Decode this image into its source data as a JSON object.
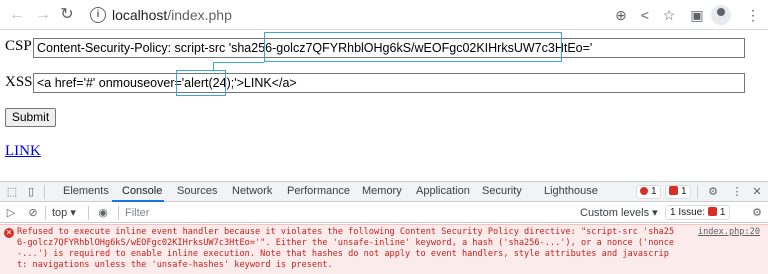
{
  "browser": {
    "url_host": "localhost",
    "url_path": "/index.php",
    "icons": [
      "back-icon",
      "forward-icon",
      "reload-icon",
      "info-icon",
      "zoom-icon",
      "share-icon",
      "bookmark-star-icon",
      "side-panel-icon",
      "profile-avatar",
      "menu-icon"
    ]
  },
  "page": {
    "csp_label": "CSP",
    "csp_value": "Content-Security-Policy: script-src 'sha256-golcz7QFYRhblOHg6kS/wEOFgc02KIHrksUW7c3HtEo='",
    "xss_label": "XSS",
    "xss_value": "<a href='#' onmouseover='alert(24);'>LINK</a>",
    "submit_label": "Submit",
    "link_text": "LINK",
    "highlight_color": "#3aa7d6"
  },
  "devtools": {
    "tabs": [
      "Elements",
      "Console",
      "Sources",
      "Network",
      "Performance",
      "Memory",
      "Application",
      "Security",
      "Lighthouse"
    ],
    "active_tab": "Console",
    "error_count": "1",
    "issue_count": "1",
    "context": "top",
    "filter_placeholder": "Filter",
    "levels_label": "Custom levels ▾",
    "issues_label": "1 Issue:",
    "issues_badge": "1",
    "message": "Refused to execute inline event handler because it violates the following Content Security Policy directive: \"script-src 'sha256-golcz7QFYRhblOHg6kS/wEOFgc02KIHrksUW7c3HtEo='\". Either the 'unsafe-inline' keyword, a hash ('sha256-...'), or a nonce ('nonce-...') is required to enable inline execution. Note that hashes do not apply to event handlers, style attributes and javascript: navigations unless the 'unsafe-hashes' keyword is present.",
    "message_source": "index.php:20",
    "error_color": "#d93025"
  }
}
